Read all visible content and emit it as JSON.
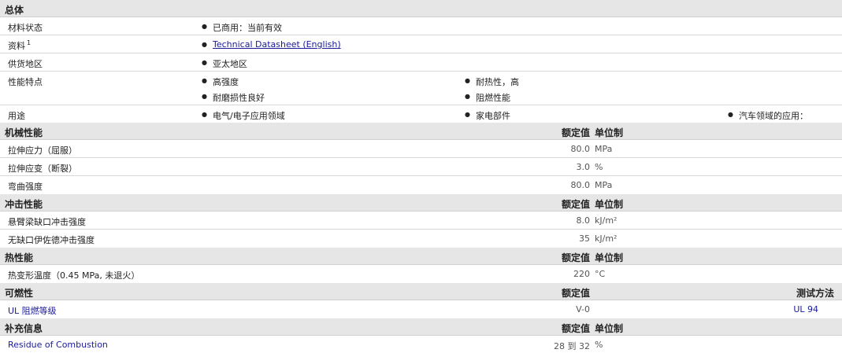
{
  "general": {
    "header": "总体",
    "rows": {
      "status": {
        "label": "材料状态",
        "items": [
          "已商用：当前有效"
        ]
      },
      "docs": {
        "label": "资料",
        "footnote": "1",
        "items": [
          "Technical Datasheet (English)"
        ]
      },
      "supply": {
        "label": "供货地区",
        "items": [
          "亚太地区"
        ]
      },
      "features": {
        "label": "性能特点",
        "items": [
          "高强度",
          "耐热性，高",
          "耐磨损性良好",
          "阻燃性能"
        ]
      },
      "uses": {
        "label": "用途",
        "items": [
          "电气/电子应用领域",
          "家电部件",
          "汽车领域的应用："
        ]
      }
    }
  },
  "mechanical": {
    "header": "机械性能",
    "val_h": "额定值",
    "unit_h": "单位制",
    "rows": [
      {
        "label": "拉伸应力（屈服）",
        "value": "80.0",
        "unit": "MPa"
      },
      {
        "label": "拉伸应变（断裂）",
        "value": "3.0",
        "unit": "%"
      },
      {
        "label": "弯曲强度",
        "value": "80.0",
        "unit": "MPa"
      }
    ]
  },
  "impact": {
    "header": "冲击性能",
    "val_h": "额定值",
    "unit_h": "单位制",
    "rows": [
      {
        "label": "悬臂梁缺口冲击强度",
        "value": "8.0",
        "unit": "kJ/m²"
      },
      {
        "label": "无缺口伊佐德冲击强度",
        "value": "35",
        "unit": "kJ/m²"
      }
    ]
  },
  "thermal": {
    "header": "热性能",
    "val_h": "额定值",
    "unit_h": "单位制",
    "rows": [
      {
        "label": "热变形温度（0.45 MPa, 未退火）",
        "value": "220",
        "unit": "°C"
      }
    ]
  },
  "flammability": {
    "header": "可燃性",
    "val_h": "额定值",
    "test_h": "测试方法",
    "rows": [
      {
        "label": "UL 阻燃等级",
        "value": "V-0",
        "test": "UL 94"
      }
    ]
  },
  "supplemental": {
    "header": "补充信息",
    "val_h": "额定值",
    "unit_h": "单位制",
    "rows": [
      {
        "label": "Residue of Combustion",
        "value": "28 到 32",
        "unit": "%"
      }
    ]
  }
}
